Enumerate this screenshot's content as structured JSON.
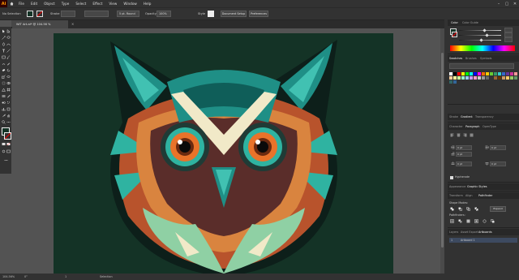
{
  "app": {
    "logo": "Ai"
  },
  "menu": [
    "File",
    "Edit",
    "Object",
    "Type",
    "Select",
    "Effect",
    "View",
    "Window",
    "Help"
  ],
  "controlbar": {
    "selection": "No Selection",
    "stroke_label": "Stroke",
    "brush": "5 pt. Round",
    "opacity_label": "Opacity",
    "opacity_value": "100%",
    "style_label": "Style",
    "doc_setup": "Document Setup",
    "preferences": "Preferences"
  },
  "document": {
    "tab_title": "WIT Art.ai* @ 104.56 % (RGB/Preview)",
    "close": "×"
  },
  "status": {
    "zoom": "104.56%",
    "angle": "0°",
    "artboard": "1",
    "mode": "Selection"
  },
  "panel": {
    "color_tabs": [
      "Color",
      "Color Guide"
    ],
    "swatch_tabs": [
      "Swatches",
      "Brushes",
      "Symbols"
    ],
    "stroke_tabs": [
      "Stroke",
      "Gradient",
      "Transparency"
    ],
    "char_tabs": [
      "Character",
      "Paragraph",
      "OpenType"
    ],
    "para_values": [
      "0 pt",
      "0 pt",
      "0 pt",
      "0 pt",
      "0 pt"
    ],
    "hyphenate": "Hyphenate",
    "appearance_tabs": [
      "Appearance",
      "Graphic Styles"
    ],
    "transform_tabs": [
      "Transform",
      "Align",
      "Pathfinder"
    ],
    "shape_modes": "Shape Modes:",
    "expand": "Expand",
    "pathfinders": "Pathfinders:",
    "layer_tabs": [
      "Layers",
      "Asset Export",
      "Artboards"
    ],
    "artboard_index": "1",
    "artboard_name": "Artboard 1"
  },
  "colors": {
    "bg": "#143326",
    "teal": "#1f8f86",
    "teal_light": "#41c1b2",
    "teal_dark": "#0f5e59",
    "rust": "#b8532c",
    "orange": "#d9843f",
    "cream": "#f1e9c8",
    "mint": "#8fd0a4",
    "brown": "#5a2d2a",
    "eye_orange": "#e9732a",
    "eye_teal": "#2fb3a1"
  },
  "swatch_colors": [
    "#ffffff",
    "#000000",
    "#ff0000",
    "#ffff00",
    "#00ff00",
    "#00ffff",
    "#0000ff",
    "#ff00ff",
    "#ff6a00",
    "#ffcc00",
    "#66cc33",
    "#339966",
    "#33cccc",
    "#3366cc",
    "#663399",
    "#cc3399",
    "#ff9999",
    "#ffcc99",
    "#ffff99",
    "#ccff99",
    "#99ffcc",
    "#99ccff",
    "#cc99ff",
    "#ff99cc",
    "#cccccc",
    "#999999",
    "#666666",
    "#333333",
    "#996633",
    "#663300",
    "#cc9966",
    "#ffcc66",
    "#99cc66",
    "#669966",
    "#336666",
    "#336699"
  ]
}
